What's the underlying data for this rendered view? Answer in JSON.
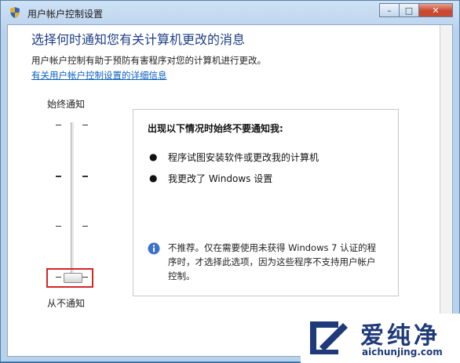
{
  "window": {
    "title": "用户帐户控制设置",
    "controls": {
      "minimize": "–",
      "maximize": "□",
      "close": "✕"
    }
  },
  "content": {
    "heading": "选择何时通知您有关计算机更改的消息",
    "description": "用户帐户控制有助于预防有害程序对您的计算机进行更改。",
    "link": "有关用户帐户控制设置的详细信息"
  },
  "slider": {
    "top_label": "始终通知",
    "bottom_label": "从不通知",
    "levels": 4,
    "selected_level": 1,
    "selected_position": "bottom"
  },
  "info_panel": {
    "title": "出现以下情况时始终不要通知我:",
    "bullets": [
      "程序试图安装软件或更改我的计算机",
      "我更改了 Windows 设置"
    ],
    "note": "不推荐。仅在需要使用未获得 Windows 7 认证的程序时，才选择此选项，因为这些程序不支持用户帐户控制。"
  },
  "watermark": {
    "brand": "爱纯净",
    "url": "aichunjing.com"
  },
  "colors": {
    "heading": "#1e3f86",
    "link": "#0b5fc0",
    "highlight": "#d32626",
    "close_button": "#c9482f"
  }
}
